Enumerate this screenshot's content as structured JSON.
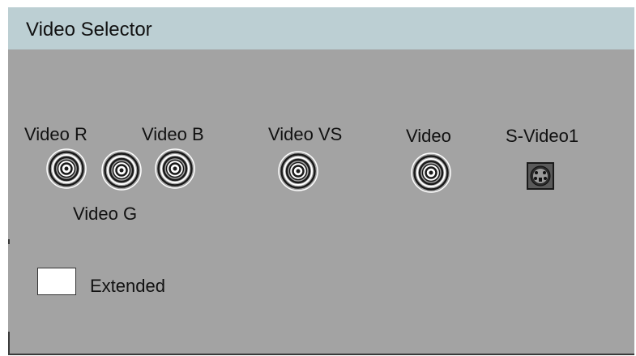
{
  "window": {
    "title": "Video Selector"
  },
  "connectors": {
    "video_r": {
      "label": "Video R"
    },
    "video_g": {
      "label": "Video G"
    },
    "video_b": {
      "label": "Video B"
    },
    "video_vs": {
      "label": "Video VS"
    },
    "video": {
      "label": "Video"
    },
    "s_video1": {
      "label": "S-Video1"
    }
  },
  "extended": {
    "label": "Extended",
    "checked": false
  },
  "icons": {
    "bnc": "bnc-connector-icon",
    "svideo": "svideo-connector-icon"
  },
  "colors": {
    "panel_bg": "#a3a3a3",
    "titlebar_bg": "#bccfd3"
  }
}
